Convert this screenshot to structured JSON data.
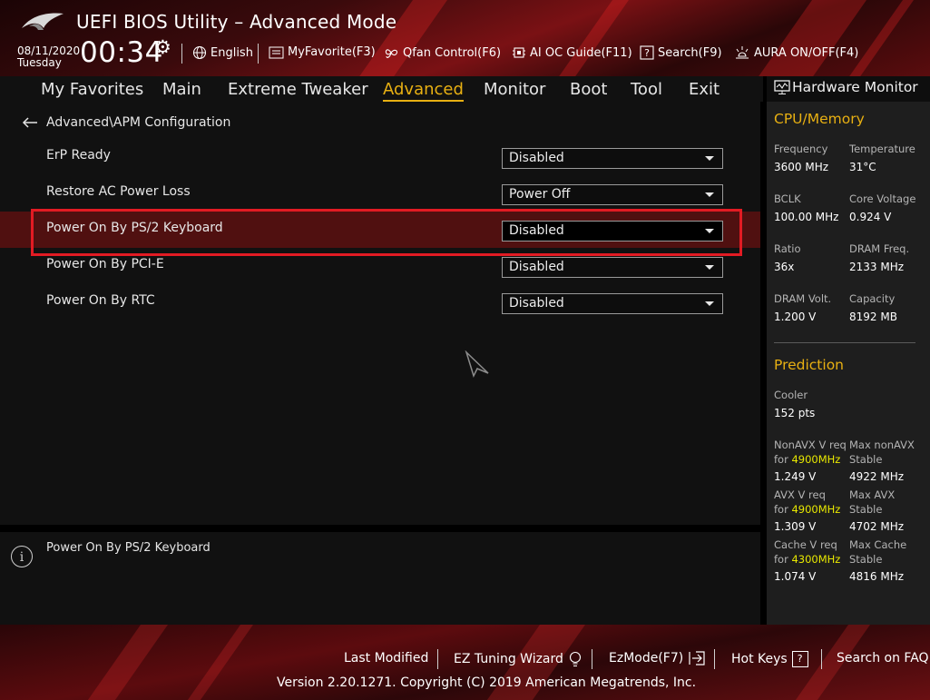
{
  "header": {
    "title": "UEFI BIOS Utility – Advanced Mode",
    "date": "08/11/2020",
    "day": "Tuesday",
    "time": "00:34",
    "toolbar": [
      {
        "label": "English",
        "icon": "globe-icon"
      },
      {
        "label": "MyFavorite(F3)",
        "icon": "favorite-icon"
      },
      {
        "label": "Qfan Control(F6)",
        "icon": "fan-icon"
      },
      {
        "label": "AI OC Guide(F11)",
        "icon": "ai-chip-icon"
      },
      {
        "label": "Search(F9)",
        "icon": "search-help-icon"
      },
      {
        "label": "AURA ON/OFF(F4)",
        "icon": "aura-light-icon"
      }
    ]
  },
  "nav": {
    "tabs": [
      "My Favorites",
      "Main",
      "Extreme Tweaker",
      "Advanced",
      "Monitor",
      "Boot",
      "Tool",
      "Exit"
    ],
    "active": "Advanced"
  },
  "main": {
    "breadcrumb": "Advanced\\APM Configuration",
    "settings": [
      {
        "label": "ErP Ready",
        "value": "Disabled"
      },
      {
        "label": "Restore AC Power Loss",
        "value": "Power Off"
      },
      {
        "label": "Power On By PS/2 Keyboard",
        "value": "Disabled"
      },
      {
        "label": "Power On By PCI-E",
        "value": "Disabled"
      },
      {
        "label": "Power On By RTC",
        "value": "Disabled"
      }
    ],
    "selected_index": 2
  },
  "help": {
    "text": "Power On By PS/2 Keyboard"
  },
  "hardware_monitor": {
    "title": "Hardware Monitor",
    "cpu_memory": {
      "title": "CPU/Memory",
      "items": [
        {
          "label": "Frequency",
          "value": "3600 MHz"
        },
        {
          "label": "Temperature",
          "value": "31°C"
        },
        {
          "label": "BCLK",
          "value": "100.00 MHz"
        },
        {
          "label": "Core Voltage",
          "value": "0.924 V"
        },
        {
          "label": "Ratio",
          "value": "36x"
        },
        {
          "label": "DRAM Freq.",
          "value": "2133 MHz"
        },
        {
          "label": "DRAM Volt.",
          "value": "1.200 V"
        },
        {
          "label": "Capacity",
          "value": "8192 MB"
        }
      ]
    },
    "prediction": {
      "title": "Prediction",
      "cooler_label": "Cooler",
      "cooler_value": "152 pts",
      "rows": [
        {
          "left_label": "NonAVX V req",
          "left_for": "for",
          "left_freq": "4900MHz",
          "left_value": "1.249 V",
          "right_label": "Max nonAVX",
          "right_sub": "Stable",
          "right_value": "4922 MHz"
        },
        {
          "left_label": "AVX V req",
          "left_for": "for",
          "left_freq": "4900MHz",
          "left_value": "1.309 V",
          "right_label": "Max AVX",
          "right_sub": "Stable",
          "right_value": "4702 MHz"
        },
        {
          "left_label": "Cache V req",
          "left_for": "for",
          "left_freq": "4300MHz",
          "left_value": "1.074 V",
          "right_label": "Max Cache",
          "right_sub": "Stable",
          "right_value": "4816 MHz"
        }
      ]
    }
  },
  "footer": {
    "last_modified": "Last Modified",
    "ez_tuning": "EZ Tuning Wizard",
    "ez_mode": "EzMode(F7)",
    "hot_keys": "Hot Keys",
    "hot_keys_key": "?",
    "search_faq": "Search on FAQ",
    "version": "Version 2.20.1271. Copyright (C) 2019 American Megatrends, Inc."
  },
  "colors": {
    "accent": "#e8b012",
    "selection_border": "#e21b23",
    "selection_row": "#501010",
    "frequency_highlight": "#e8e800"
  }
}
